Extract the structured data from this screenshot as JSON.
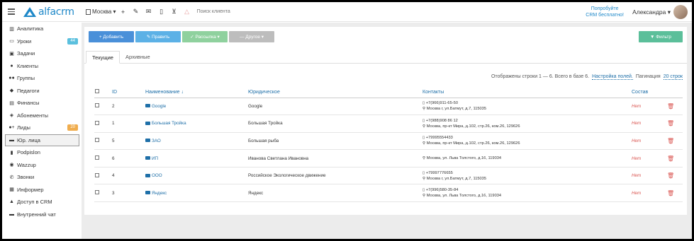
{
  "colors": {
    "primary": "#4a90d9",
    "success": "#5cb85c",
    "light_success": "#8fd19e",
    "disabled": "#bdbdbd",
    "filter": "#5bbf9a",
    "danger": "#d9534f",
    "link": "#1e6fa8"
  },
  "header": {
    "logo_text": "alfacrm",
    "branch_label": "Москва ▾",
    "icons": [
      {
        "name": "plus-icon",
        "glyph": "+"
      },
      {
        "name": "wrench-icon",
        "glyph": "✎"
      },
      {
        "name": "mail-icon",
        "glyph": "✉"
      },
      {
        "name": "phone-icon",
        "glyph": "▯"
      },
      {
        "name": "cart-icon",
        "glyph": "⊻"
      },
      {
        "name": "bell-icon",
        "glyph": "△"
      }
    ],
    "search_placeholder": "Поиск клиента",
    "promo_line1": "Попробуйте",
    "promo_line2": "CRM бесплатно!",
    "user_name": "Александра ▾"
  },
  "sidebar": {
    "items": [
      {
        "name": "sidebar-item-analytics",
        "icon": "analytics-icon",
        "glyph": "▥",
        "label": "Аналитика"
      },
      {
        "name": "sidebar-item-lessons",
        "icon": "calendar-icon",
        "glyph": "▭",
        "label": "Уроки",
        "badge": "44",
        "badge_color": "#5bc0de"
      },
      {
        "name": "sidebar-item-tasks",
        "icon": "tasks-icon",
        "glyph": "▣",
        "label": "Задачи"
      },
      {
        "name": "sidebar-item-clients",
        "icon": "user-icon",
        "glyph": "●",
        "label": "Клиенты"
      },
      {
        "name": "sidebar-item-groups",
        "icon": "users-icon",
        "glyph": "●●",
        "label": "Группы"
      },
      {
        "name": "sidebar-item-teachers",
        "icon": "graduation-cap-icon",
        "glyph": "◆",
        "label": "Педагоги"
      },
      {
        "name": "sidebar-item-finance",
        "icon": "money-icon",
        "glyph": "▤",
        "label": "Финансы"
      },
      {
        "name": "sidebar-item-subscriptions",
        "icon": "tag-icon",
        "glyph": "◈",
        "label": "Абонементы"
      },
      {
        "name": "sidebar-item-leads",
        "icon": "user-plus-icon",
        "glyph": "●+",
        "label": "Лиды",
        "badge": "20",
        "badge_color": "#f0ad4e"
      },
      {
        "name": "sidebar-item-legal",
        "icon": "briefcase-icon",
        "glyph": "▬",
        "label": "Юр. лица",
        "active": true
      },
      {
        "name": "sidebar-item-podpislon",
        "icon": "file-icon",
        "glyph": "▮",
        "label": "Podpislon"
      },
      {
        "name": "sidebar-item-wazzup",
        "icon": "whatsapp-icon",
        "glyph": "◉",
        "label": "Wazzup"
      },
      {
        "name": "sidebar-item-calls",
        "icon": "phone-icon",
        "glyph": "✆",
        "label": "Звонки"
      },
      {
        "name": "sidebar-item-informer",
        "icon": "informer-icon",
        "glyph": "▦",
        "label": "Информер"
      },
      {
        "name": "sidebar-item-crm-access",
        "icon": "lock-icon",
        "glyph": "▲",
        "label": "Доступ в CRM"
      },
      {
        "name": "sidebar-item-internal-chat",
        "icon": "chat-icon",
        "glyph": "▬",
        "label": "Внутренний чат"
      }
    ]
  },
  "toolbar": {
    "add_label": "+ Добавить",
    "edit_label": "✎ Править",
    "mailing_label": "✓ Рассылка ▾",
    "other_label": "— Другое ▾",
    "filter_label": "▼ Фильтр"
  },
  "tabs": {
    "current": "Текущие",
    "archive": "Архивные"
  },
  "pager": {
    "summary": "Отображены строки 1 — 6. Всего в базе 6.",
    "settings_link": "Настройка полей.",
    "pagination_label": "Пагинация",
    "pagination_link": "20 строк"
  },
  "table": {
    "headers": {
      "id": "ID",
      "name": "Наименование ↓",
      "legal": "Юридическое",
      "contacts": "Контакты",
      "composition": "Состав"
    },
    "rows": [
      {
        "id": "2",
        "name": "Google",
        "legal": "Google",
        "phone": "▯ +7(966)911-65-50",
        "address": "⚲ Москва г, ул.Батмут, д.7, 115035",
        "composition": "Нет"
      },
      {
        "id": "1",
        "name": "Большая Тройка",
        "legal": "Большая Тройка",
        "phone": "▯ +7(988)908 86 12",
        "address": "⚲ Москва, пр-кт Мира, д.102, стр.26, ком.26, 129626",
        "composition": "Нет"
      },
      {
        "id": "5",
        "name": "ЗАО",
        "legal": "Большая рыба",
        "phone": "▯ +79995554433",
        "address": "⚲ Москва, пр-кт Мира, д.102, стр.26, ком.26, 129626",
        "composition": "Нет"
      },
      {
        "id": "6",
        "name": "ИП",
        "legal": "Иванова Светлана Ивановна",
        "phone": "",
        "address": "⚲ Москва, ул. Льва Толстого, д.16, 119034",
        "composition": "Нет"
      },
      {
        "id": "4",
        "name": "ООО",
        "legal": "Российское Экологическое движение",
        "phone": "▯ +79997776655",
        "address": "⚲ Москва г, ул.Батмут, д.7, 115035",
        "composition": "Нет"
      },
      {
        "id": "3",
        "name": "Яндекс",
        "legal": "Яндекс",
        "phone": "▯ +7(996)580-35-84",
        "address": "⚲ Москва, ул. Льва Толстого, д.16, 119034",
        "composition": "Нет"
      }
    ]
  }
}
